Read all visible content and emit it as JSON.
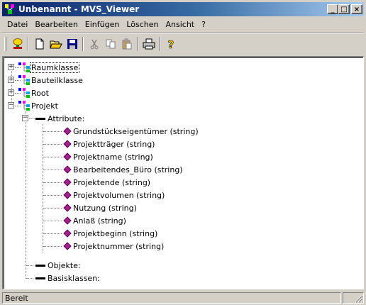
{
  "window": {
    "title": "Unbenannt - MVS_Viewer",
    "minimize_glyph": "_",
    "maximize_glyph": "□",
    "close_glyph": "×"
  },
  "menu": {
    "items": [
      "Datei",
      "Bearbeiten",
      "Einfügen",
      "Löschen",
      "Ansicht",
      "?"
    ]
  },
  "toolbar": {
    "buttons": [
      "connect-icon",
      "new-file-icon",
      "open-folder-icon",
      "save-icon",
      "cut-icon",
      "copy-icon",
      "paste-icon",
      "print-icon",
      "help-icon"
    ]
  },
  "tree": {
    "nodes": [
      {
        "label": "Raumklasse",
        "expander": "+",
        "selected": true
      },
      {
        "label": "Bauteilklasse",
        "expander": "+"
      },
      {
        "label": "Root",
        "expander": "+"
      },
      {
        "label": "Projekt",
        "expander": "−"
      },
      {
        "label": "Attribute:",
        "expander": "−"
      },
      {
        "label": "Grundstückseigentümer (string)"
      },
      {
        "label": "Projektträger (string)"
      },
      {
        "label": "Projektname (string)"
      },
      {
        "label": "Bearbeitendes_Büro (string)"
      },
      {
        "label": "Projektende (string)"
      },
      {
        "label": "Projektvolumen (string)"
      },
      {
        "label": "Nutzung (string)"
      },
      {
        "label": "Anlaß (string)"
      },
      {
        "label": "Projektbeginn (string)"
      },
      {
        "label": "Projektnummer (string)"
      },
      {
        "label": "Objekte:"
      },
      {
        "label": "Basisklassen:"
      }
    ]
  },
  "status": {
    "text": "Bereit"
  },
  "colors": {
    "title_start": "#0a246a",
    "title_end": "#a6caf0",
    "attr_diamond": "#a0208c"
  }
}
